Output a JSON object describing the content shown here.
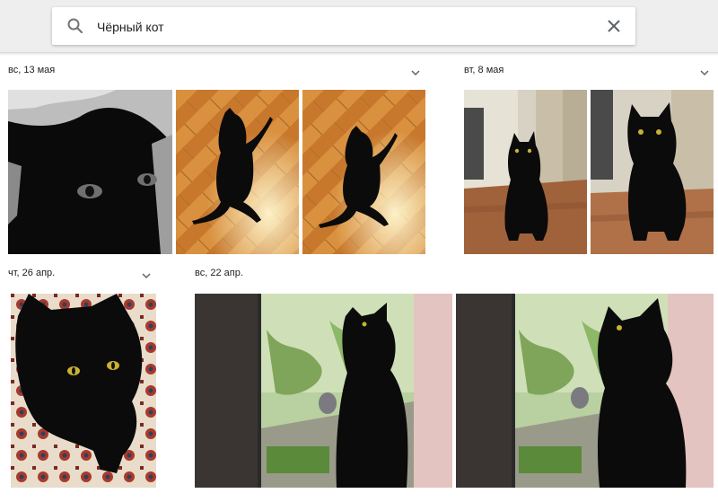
{
  "search": {
    "query": "Чёрный кот",
    "placeholder": "Чёрный кот",
    "search_icon": "search-icon",
    "clear_icon": "close-icon"
  },
  "groups": [
    {
      "date": "вс, 13 мая",
      "photos": [
        "black-cat-closeup",
        "black-cat-on-parquet",
        "black-cat-on-parquet"
      ]
    },
    {
      "date": "вт, 8 мая",
      "photos": [
        "black-cat-sitting-room",
        "black-cat-sitting-room"
      ]
    },
    {
      "date": "чт, 26 апр.",
      "photos": [
        "black-cat-on-carpet"
      ]
    },
    {
      "date": "вс, 22 апр.",
      "photos": [
        "black-cat-at-window",
        "black-cat-at-window"
      ]
    }
  ],
  "colors": {
    "topbar": "#eeeeee",
    "background": "#ffffff",
    "text": "#202124"
  }
}
